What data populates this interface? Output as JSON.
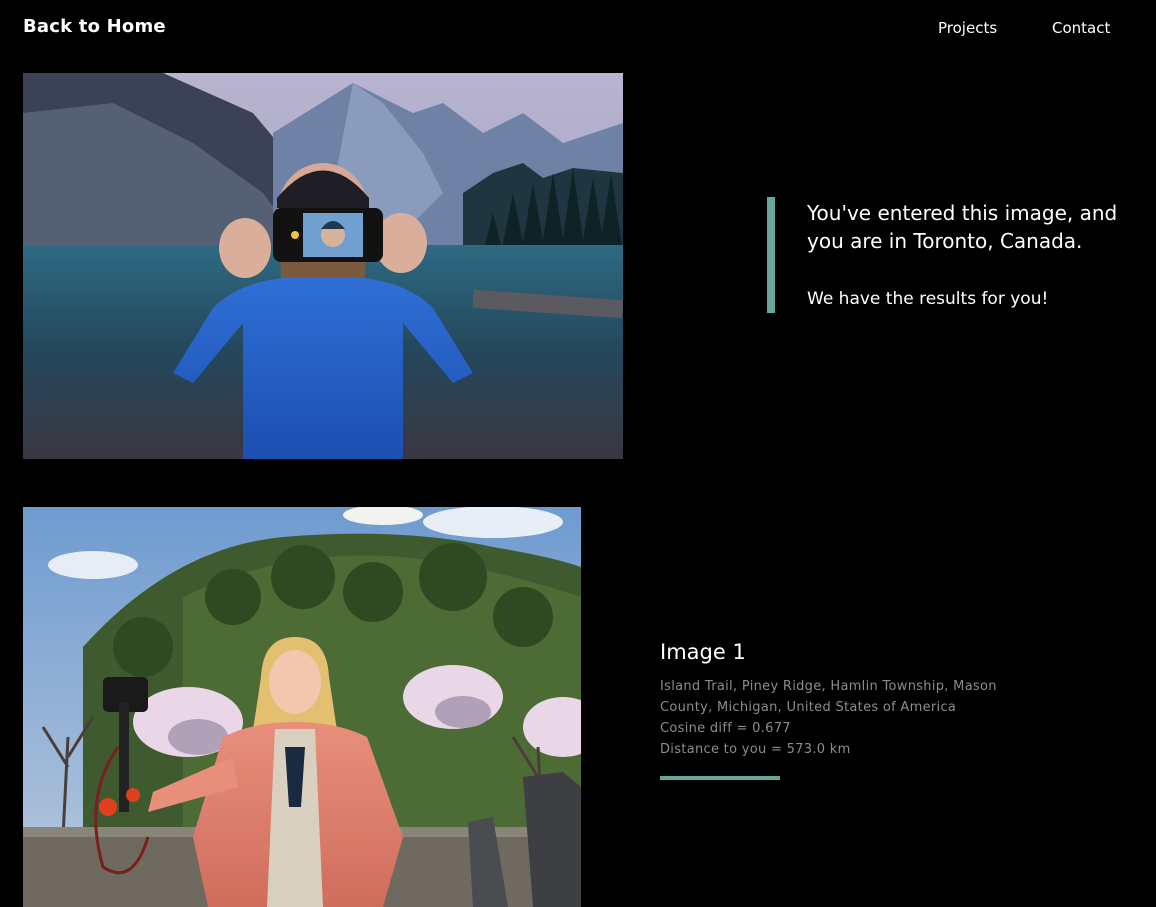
{
  "nav": {
    "home_label": "Back to Home",
    "projects_label": "Projects",
    "contact_label": "Contact"
  },
  "query": {
    "line1": "You've entered this image, and you are in Toronto, Canada.",
    "line2": "We have the results for you!",
    "photo_icon": "photo-person-taking-selfie-at-mountain-lake",
    "accent_color": "#6aa59b"
  },
  "results": [
    {
      "title": "Image 1",
      "address": "Island Trail, Piney Ridge, Hamlin Township, Mason County, Michigan, United States of America",
      "cosine": "Cosine diff = 0.677",
      "distance": "Distance to you = 573.0 km",
      "photo_icon": "photo-woman-with-camera-rig-by-blossom-trees"
    }
  ]
}
